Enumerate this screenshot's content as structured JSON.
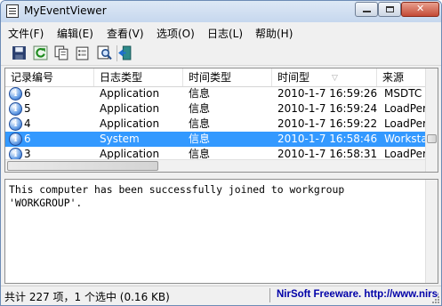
{
  "window": {
    "title": "MyEventViewer"
  },
  "menu": [
    {
      "label": "文件(F)"
    },
    {
      "label": "编辑(E)"
    },
    {
      "label": "查看(V)"
    },
    {
      "label": "选项(O)"
    },
    {
      "label": "日志(L)"
    },
    {
      "label": "帮助(H)"
    }
  ],
  "toolbar": {
    "buttons": [
      "save-icon",
      "refresh-icon",
      "copy-icon",
      "properties-icon",
      "find-icon",
      "exit-icon"
    ]
  },
  "list": {
    "columns": [
      "记录编号",
      "日志类型",
      "时间类型",
      "时间型",
      "来源"
    ],
    "sorted_column": "时间型",
    "rows": [
      {
        "id": "6",
        "log": "Application",
        "type": "信息",
        "time": "2010-1-7 16:59:26",
        "source": "MSDTC",
        "selected": false
      },
      {
        "id": "5",
        "log": "Application",
        "type": "信息",
        "time": "2010-1-7 16:59:24",
        "source": "LoadPer",
        "selected": false
      },
      {
        "id": "4",
        "log": "Application",
        "type": "信息",
        "time": "2010-1-7 16:59:22",
        "source": "LoadPer",
        "selected": false
      },
      {
        "id": "6",
        "log": "System",
        "type": "信息",
        "time": "2010-1-7 16:58:46",
        "source": "Worksta",
        "selected": true
      },
      {
        "id": "3",
        "log": "Application",
        "type": "信息",
        "time": "2010-1-7 16:58:31",
        "source": "LoadPer",
        "selected": false
      }
    ]
  },
  "details": {
    "text": "This computer has been successfully joined to workgroup\n'WORKGROUP'."
  },
  "status": {
    "summary": "共计 227 项，1 个选中   (0.16 KB)",
    "credit": "NirSoft Freeware.  http://www.nirsoft.net"
  },
  "colors": {
    "selection": "#3399ff",
    "link": "#0000a8"
  }
}
